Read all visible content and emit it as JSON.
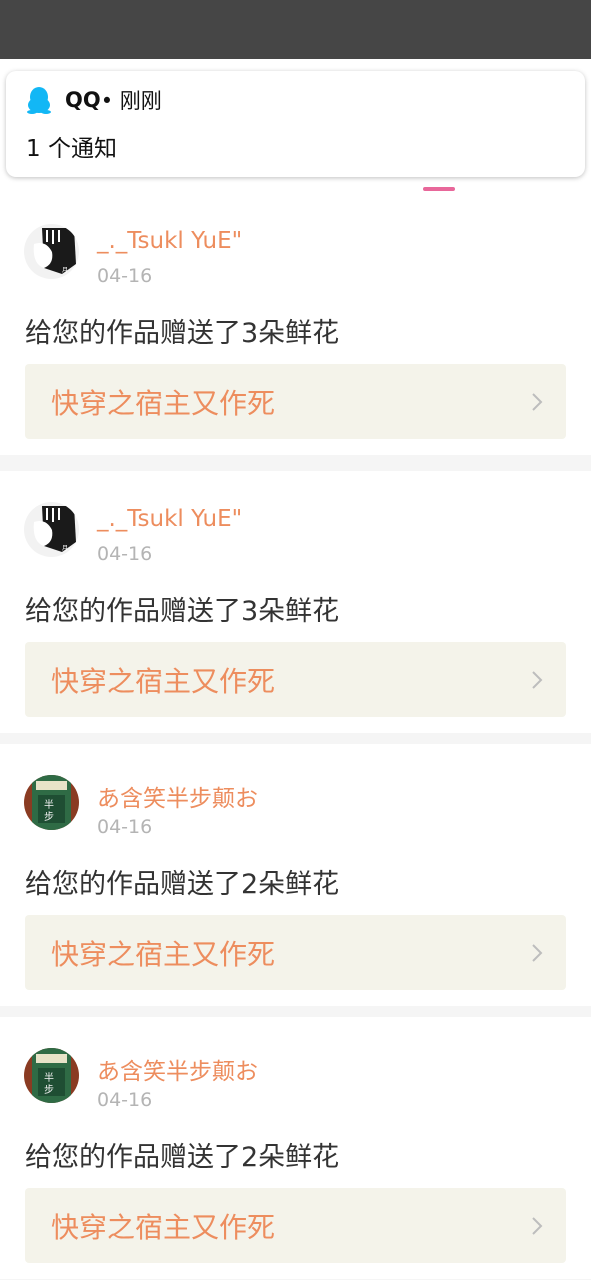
{
  "notification": {
    "app_name": "QQ",
    "time": " • 刚刚",
    "body": "1 个通知",
    "icon": "qq-penguin-icon",
    "icon_color": "#12b7f5"
  },
  "colors": {
    "accent": "#ed8d5e",
    "tab_indicator": "#e8679a",
    "status_bar": "#464646",
    "card_link_bg": "#f4f3ea"
  },
  "items": [
    {
      "username": "_._Tsukl YuE\"",
      "date": "04-16",
      "message": "给您的作品赠送了3朵鲜花",
      "work_title": "快穿之宿主又作死",
      "avatar": "bw-anime-avatar"
    },
    {
      "username": "_._Tsukl YuE\"",
      "date": "04-16",
      "message": "给您的作品赠送了3朵鲜花",
      "work_title": "快穿之宿主又作死",
      "avatar": "bw-anime-avatar"
    },
    {
      "username": "あ含笑半步颠お",
      "date": "04-16",
      "message": "给您的作品赠送了2朵鲜花",
      "work_title": "快穿之宿主又作死",
      "avatar": "green-label-avatar"
    },
    {
      "username": "あ含笑半步颠お",
      "date": "04-16",
      "message": "给您的作品赠送了2朵鲜花",
      "work_title": "快穿之宿主又作死",
      "avatar": "green-label-avatar"
    }
  ]
}
